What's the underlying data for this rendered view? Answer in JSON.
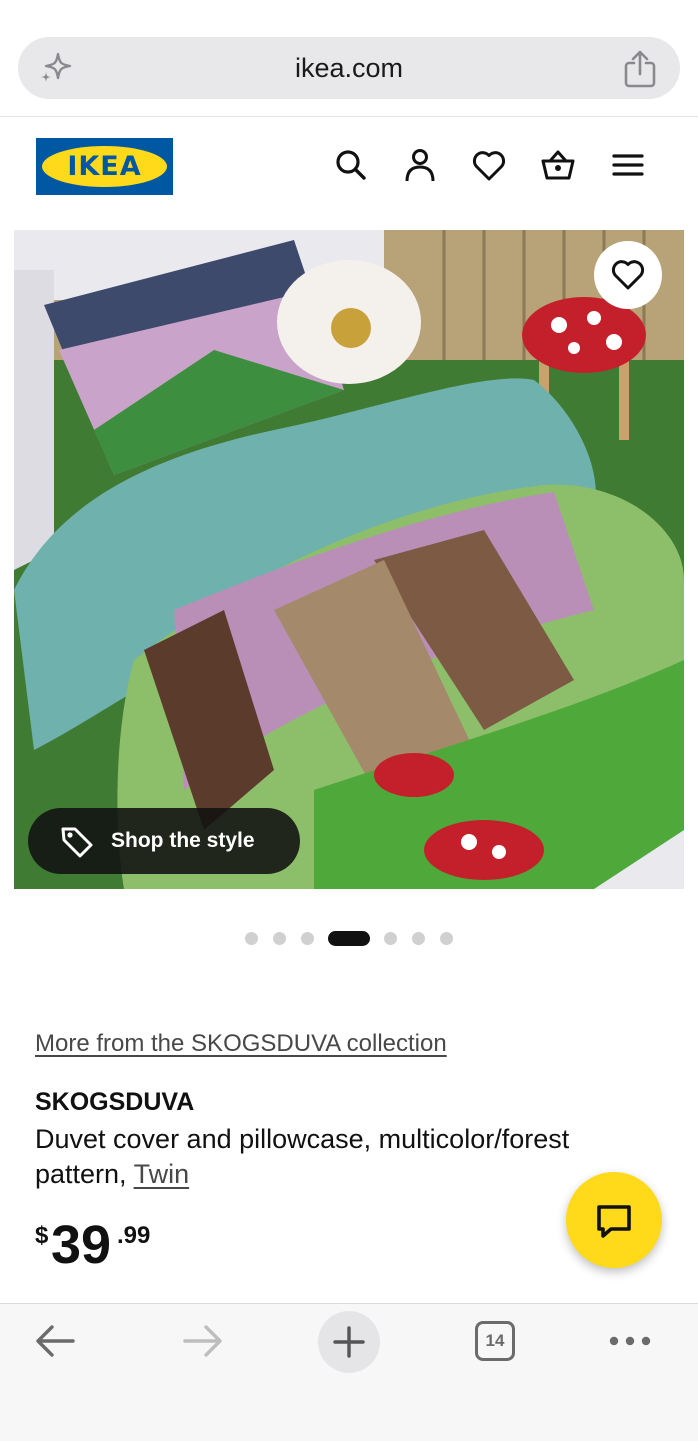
{
  "browser": {
    "url": "ikea.com",
    "left_icon": "sparkle-icon",
    "right_icon": "share-icon"
  },
  "header": {
    "logo_text": "IKEA",
    "icons": [
      "search-icon",
      "account-icon",
      "heart-icon",
      "basket-icon",
      "menu-icon"
    ],
    "colors": {
      "logo_blue": "#0058a3",
      "logo_yellow": "#ffda1a"
    }
  },
  "hero": {
    "image_alt": "",
    "favorite_icon": "heart-icon",
    "shop_the_style": "Shop the style",
    "shop_icon": "tag-icon"
  },
  "carousel": {
    "total": 7,
    "active_index": 3
  },
  "product": {
    "collection_link": "More from the SKOGSDUVA collection",
    "name": "SKOGSDUVA",
    "description": "Duvet cover and pillowcase, multicolor/forest pattern, ",
    "variant": "Twin",
    "price": {
      "currency": "$",
      "integer": "39",
      "decimals": ".99"
    }
  },
  "chat": {
    "icon": "chat-icon",
    "color": "#ffda1a"
  },
  "bottom_nav": {
    "icons": [
      "back-arrow-icon",
      "forward-arrow-icon",
      "plus-icon",
      "tabs-icon",
      "more-icon"
    ],
    "tabs_count": "14"
  }
}
